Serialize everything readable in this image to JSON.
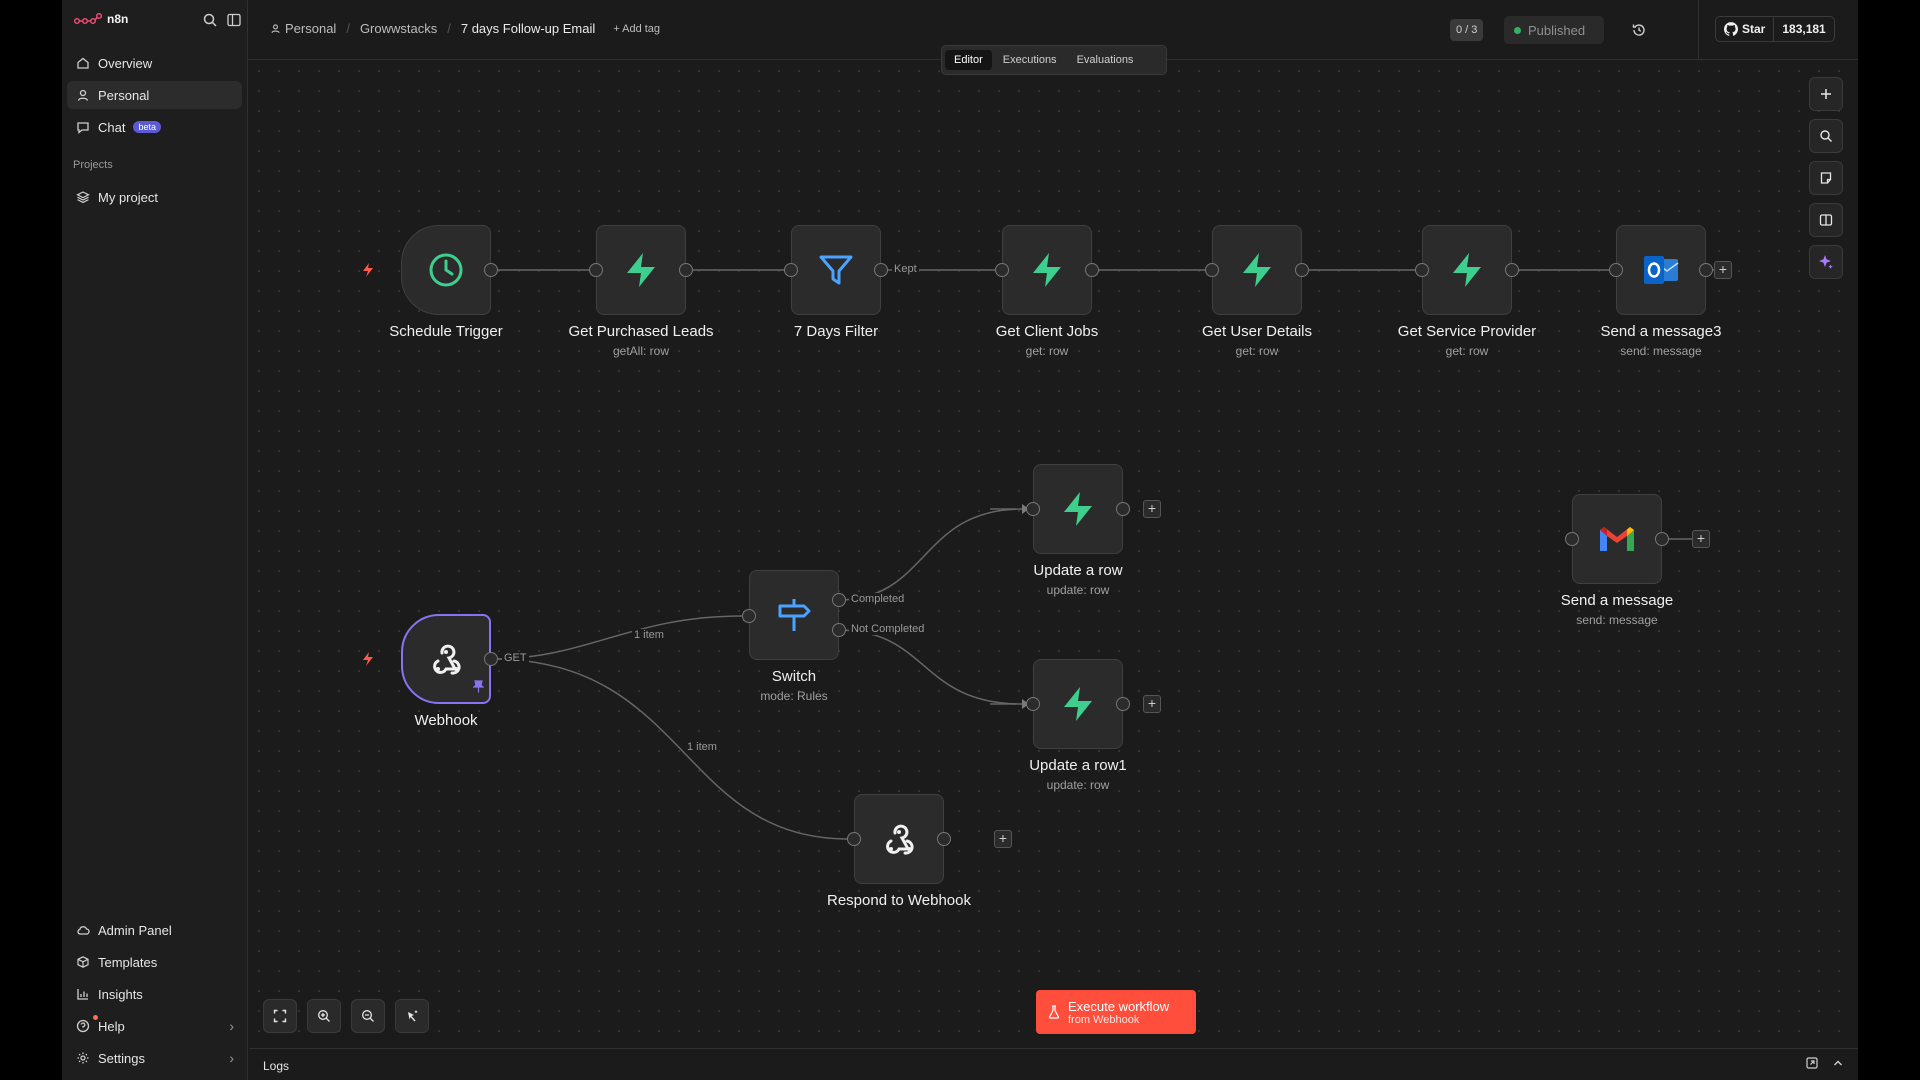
{
  "app": {
    "name": "n8n"
  },
  "sidebar": {
    "items": [
      {
        "label": "Overview",
        "icon": "home-icon"
      },
      {
        "label": "Personal",
        "icon": "user-icon"
      },
      {
        "label": "Chat",
        "icon": "chat-icon",
        "badge": "beta"
      }
    ],
    "projects_label": "Projects",
    "projects": [
      {
        "label": "My project",
        "icon": "layers-icon"
      }
    ],
    "bottom": [
      {
        "label": "Admin Panel",
        "icon": "cloud-icon"
      },
      {
        "label": "Templates",
        "icon": "box-icon"
      },
      {
        "label": "Insights",
        "icon": "bar-chart-icon"
      },
      {
        "label": "Help",
        "icon": "help-icon"
      },
      {
        "label": "Settings",
        "icon": "gear-icon"
      }
    ]
  },
  "header": {
    "breadcrumb": [
      "Personal",
      "Growwstacks",
      "7 days Follow-up Email"
    ],
    "add_tag": "+ Add tag",
    "counter": "0 / 3",
    "status": "Published",
    "github_star": "Star",
    "github_count": "183,181",
    "tabs": [
      "Editor",
      "Executions",
      "Evaluations"
    ],
    "active_tab": "Editor"
  },
  "nodes": {
    "schedule": {
      "label": "Schedule Trigger",
      "sub": ""
    },
    "purchased": {
      "label": "Get Purchased Leads",
      "sub": "getAll: row"
    },
    "filter": {
      "label": "7 Days Filter",
      "sub": ""
    },
    "client_jobs": {
      "label": "Get Client Jobs",
      "sub": "get: row"
    },
    "user_details": {
      "label": "Get User Details",
      "sub": "get: row"
    },
    "service_provider": {
      "label": "Get Service Provider",
      "sub": "get: row"
    },
    "send3": {
      "label": "Send a message3",
      "sub": "send: message"
    },
    "update_row": {
      "label": "Update a row",
      "sub": "update: row"
    },
    "update_row1": {
      "label": "Update a row1",
      "sub": "update: row"
    },
    "gmail": {
      "label": "Send a message",
      "sub": "send: message"
    },
    "webhook": {
      "label": "Webhook",
      "sub": ""
    },
    "switch": {
      "label": "Switch",
      "sub": "mode: Rules"
    },
    "respond": {
      "label": "Respond to Webhook",
      "sub": ""
    }
  },
  "edges": {
    "kept": "Kept",
    "get": "GET",
    "item1": "1 item",
    "item2": "1 item",
    "completed": "Completed",
    "not_completed": "Not Completed"
  },
  "execute": {
    "title": "Execute workflow",
    "sub": "from Webhook"
  },
  "logs": {
    "label": "Logs"
  },
  "colors": {
    "accent": "#ff4e3b",
    "supabase": "#3ecf8e",
    "selected": "#8a72f0",
    "published_dot": "#2fb35c"
  }
}
